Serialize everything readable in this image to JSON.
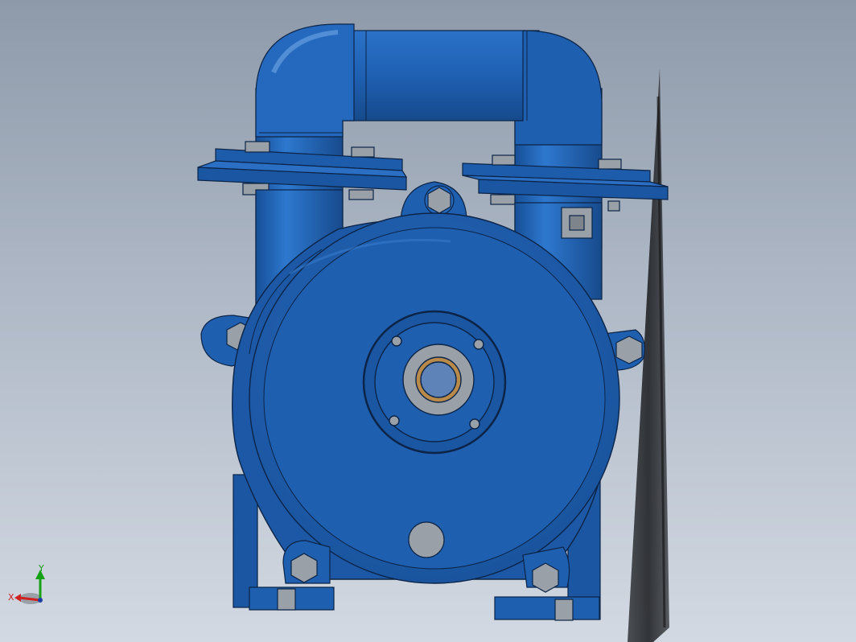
{
  "viewport": {
    "background_top": "#8e9aaa",
    "background_bottom": "#d3d9e2"
  },
  "model": {
    "body_color": "#1f5fb0",
    "body_dark": "#164a8c",
    "body_light": "#2b72c8",
    "edge_color": "#0b2447",
    "bolt_color": "#9aa0a8",
    "bushing_color": "#b98a4a"
  },
  "triad": {
    "x_label": "X",
    "y_label": "Y",
    "x_color": "#d02020",
    "y_color": "#16a016"
  }
}
